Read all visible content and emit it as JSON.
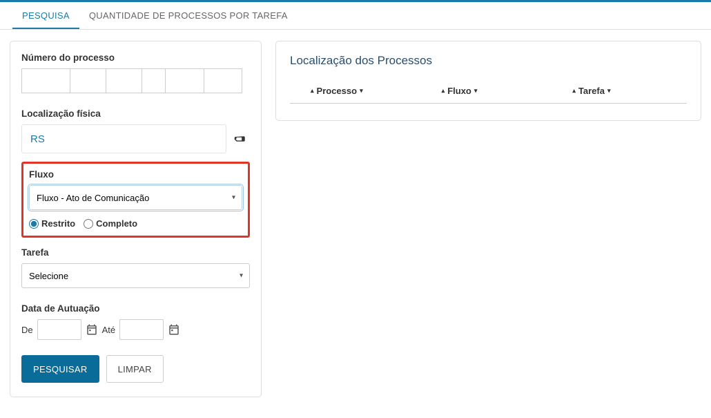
{
  "tabs": {
    "pesquisa": "PESQUISA",
    "quantidade": "QUANTIDADE DE PROCESSOS POR TAREFA"
  },
  "form": {
    "numero_label": "Número do processo",
    "localizacao_label": "Localização física",
    "localizacao_value": "RS",
    "fluxo_label": "Fluxo",
    "fluxo_selected": "Fluxo - Ato de Comunicação",
    "radio_restrito": "Restrito",
    "radio_completo": "Completo",
    "tarefa_label": "Tarefa",
    "tarefa_selected": "Selecione",
    "data_autuacao_label": "Data de Autuação",
    "date_de": "De",
    "date_ate": "Até",
    "btn_pesquisar": "PESQUISAR",
    "btn_limpar": "LIMPAR"
  },
  "results": {
    "title": "Localização dos Processos",
    "col_processo": "Processo",
    "col_fluxo": "Fluxo",
    "col_tarefa": "Tarefa"
  }
}
